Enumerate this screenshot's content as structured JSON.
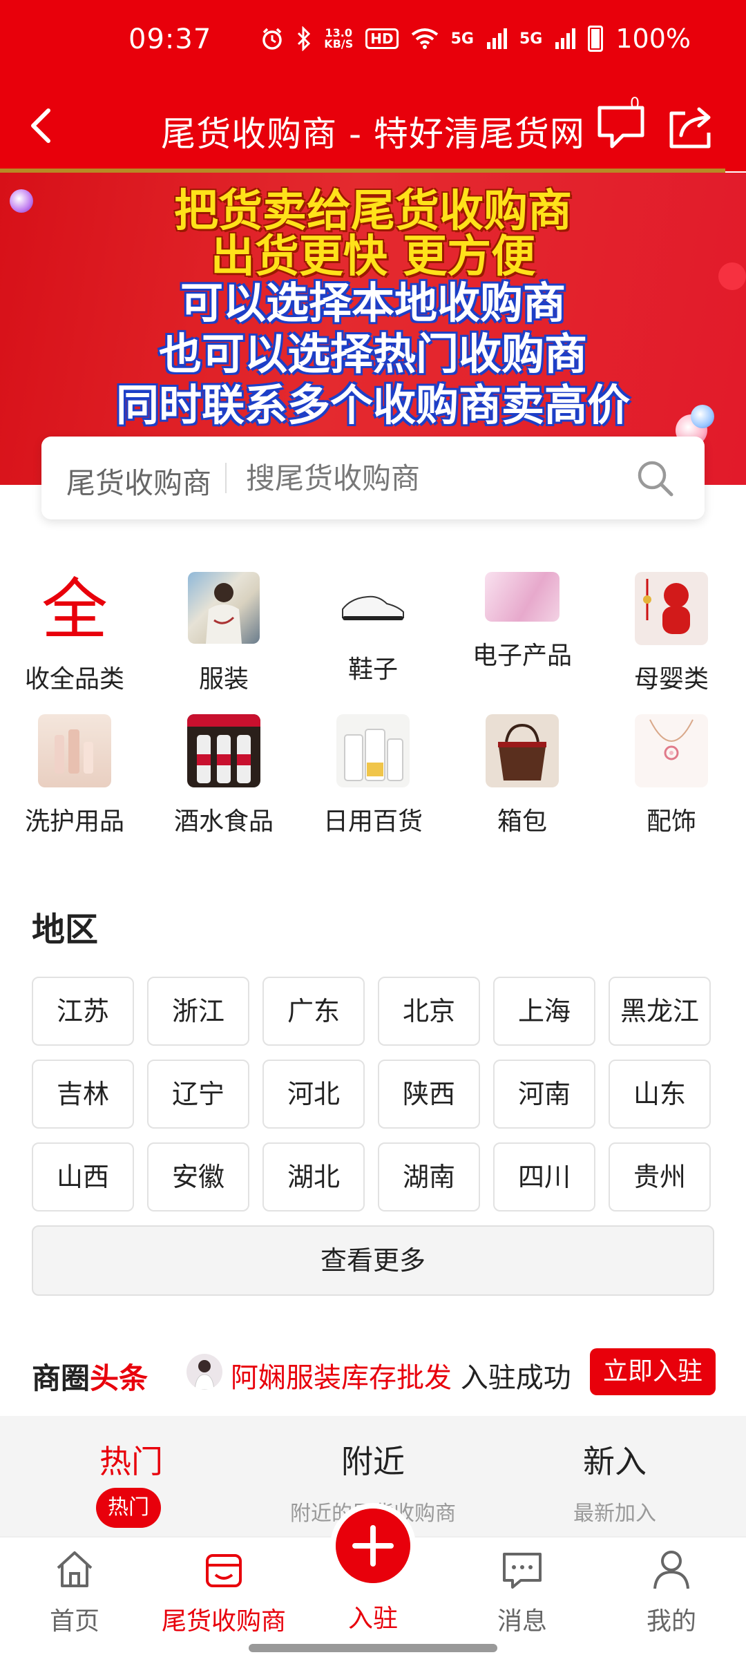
{
  "status_bar": {
    "time": "09:37",
    "net_speed_value": "13.0",
    "net_speed_unit": "KB/S",
    "hd_badge": "HD",
    "signal1": "5G",
    "signal2": "5G",
    "battery": "100%",
    "icons": [
      "alarm-icon",
      "bluetooth-icon",
      "wifi-icon",
      "signal-icon",
      "battery-icon"
    ]
  },
  "header": {
    "title": "尾货收购商 - 特好清尾货网",
    "message_count": "0",
    "icons": [
      "back-icon",
      "message-icon",
      "share-icon"
    ]
  },
  "banner": {
    "line1": "把货卖给尾货收购商",
    "line2": "出货更快 更方便",
    "line3": "可以选择本地收购商",
    "line4": "也可以选择热门收购商",
    "line5": "同时联系多个收购商卖高价"
  },
  "search": {
    "category": "尾货收购商",
    "placeholder": "搜尾货收购商"
  },
  "categories": [
    {
      "label": "收全品类",
      "icon": "quan-char"
    },
    {
      "label": "服装"
    },
    {
      "label": "鞋子"
    },
    {
      "label": "电子产品"
    },
    {
      "label": "母婴类"
    },
    {
      "label": "洗护用品"
    },
    {
      "label": "酒水食品"
    },
    {
      "label": "日用百货"
    },
    {
      "label": "箱包"
    },
    {
      "label": "配饰"
    }
  ],
  "category_quan_char": "全",
  "region": {
    "title": "地区",
    "items": [
      "江苏",
      "浙江",
      "广东",
      "北京",
      "上海",
      "黑龙江",
      "吉林",
      "辽宁",
      "河北",
      "陕西",
      "河南",
      "山东",
      "山西",
      "安徽",
      "湖北",
      "湖南",
      "四川",
      "贵州"
    ],
    "more": "查看更多"
  },
  "news": {
    "title_part1": "商圈",
    "title_part2": "头条",
    "highlight": "阿娴服装库存批发",
    "text": " 入驻成功",
    "join_button": "立即入驻"
  },
  "tabs": [
    {
      "title": "热门",
      "sub": "热门",
      "active": true
    },
    {
      "title": "附近",
      "sub": "附近的尾货收购商"
    },
    {
      "title": "新入",
      "sub": "最新加入"
    }
  ],
  "bottom_nav": [
    {
      "label": "首页",
      "icon": "home-icon"
    },
    {
      "label": "尾货收购商",
      "icon": "shop-icon",
      "active": true
    },
    {
      "label": "入驻",
      "icon": "plus-icon"
    },
    {
      "label": "消息",
      "icon": "chat-icon"
    },
    {
      "label": "我的",
      "icon": "user-icon"
    }
  ],
  "colors": {
    "brand_red": "#e8000b",
    "banner_yellow": "#ffe21a",
    "banner_blue": "#1d3fc7"
  }
}
